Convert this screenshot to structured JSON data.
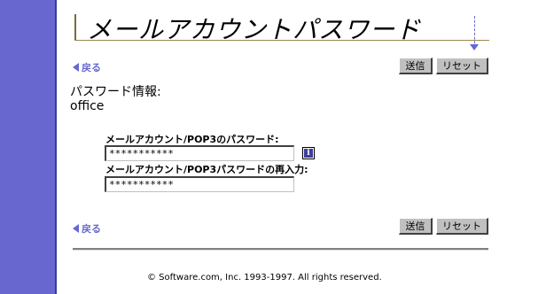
{
  "header": {
    "title": "メールアカウントパスワード"
  },
  "nav": {
    "back_label": "戻る"
  },
  "toolbar": {
    "submit_label": "送信",
    "reset_label": "リセット"
  },
  "section": {
    "heading": "パスワード情報:",
    "account_name": "office"
  },
  "form": {
    "password_label": "メールアカウント/POP3のパスワード:",
    "password_value": "***********",
    "confirm_label": "メールアカウント/POP3パスワードの再入力:",
    "confirm_value": "***********",
    "info_icon_glyph": "i"
  },
  "footer": {
    "copyright": "© Software.com, Inc. 1993-1997. All rights reserved."
  },
  "colors": {
    "sidebar": "#6767cf",
    "link": "#6767cf",
    "button_face": "#c0c0c0"
  },
  "icons": [
    "back-arrow-icon",
    "info-icon",
    "scroll-down-arrow-icon"
  ]
}
